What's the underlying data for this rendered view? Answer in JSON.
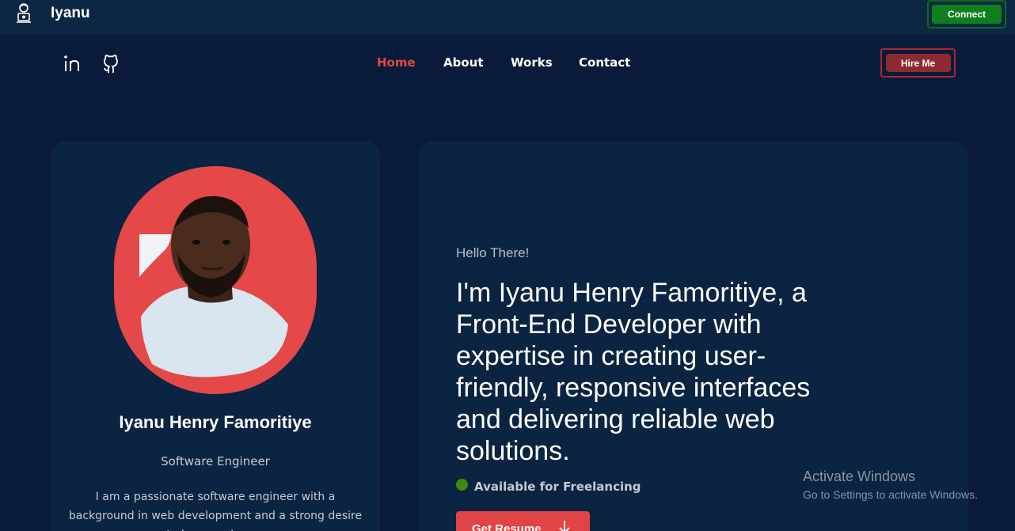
{
  "topbar": {
    "brand_name": "Iyanu",
    "brand_icon": "user-laptop-icon",
    "connect_label": "Connect"
  },
  "nav": {
    "social": [
      {
        "icon": "linkedin-icon"
      },
      {
        "icon": "github-icon"
      }
    ],
    "links": [
      {
        "label": "Home",
        "active": true
      },
      {
        "label": "About",
        "active": false
      },
      {
        "label": "Works",
        "active": false
      },
      {
        "label": "Contact",
        "active": false
      }
    ],
    "hire_label": "Hire Me"
  },
  "profile": {
    "name": "Iyanu Henry Famoritiye",
    "role": "Software Engineer",
    "bio": "I am a passionate software engineer with a background in web development and a strong desire to learn and grow"
  },
  "hero": {
    "greeting": "Hello There!",
    "headline": "I'm Iyanu Henry Famoritiye, a Front-End Developer with expertise in creating user-friendly, responsive interfaces and delivering reliable web solutions.",
    "availability": "Available for Freelancing",
    "resume_label": "Get Resume"
  },
  "watermark": {
    "title": "Activate Windows",
    "subtitle": "Go to Settings to activate Windows."
  },
  "colors": {
    "background": "#0a1a3a",
    "card": "#0b2441",
    "accent_red": "#e04848",
    "connect_green": "#0f7f1e",
    "available_green": "#3d8a0f"
  }
}
